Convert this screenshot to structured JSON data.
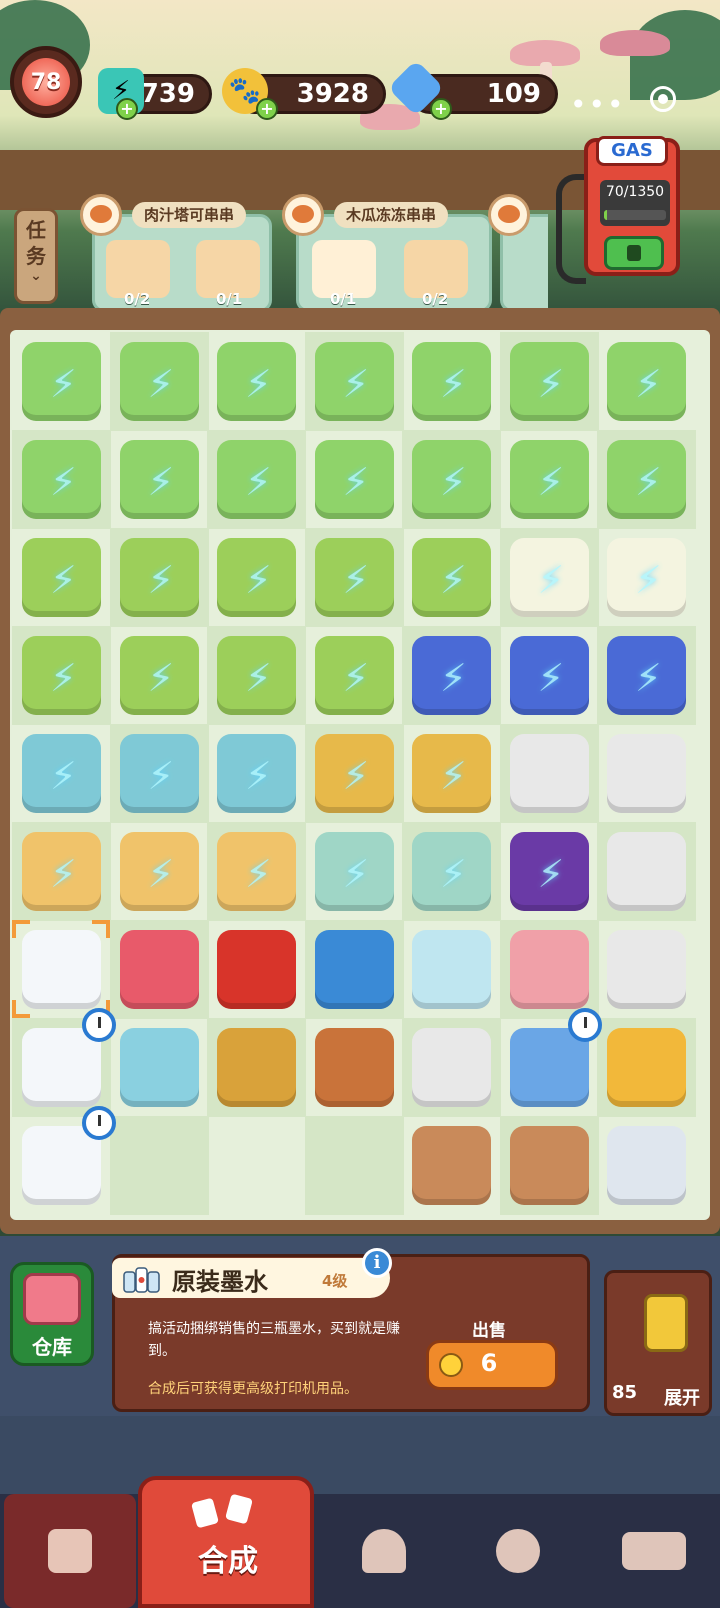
{
  "header": {
    "level": "78",
    "energy": "739",
    "paw_coins": "3928",
    "gems": "109",
    "more_icon": "more-dots-icon",
    "settings_icon": "target-icon"
  },
  "tasks": {
    "tab_label": "任务",
    "cards": [
      {
        "title": "肉汁塔可串串",
        "ingredients": [
          {
            "count": "0/2"
          },
          {
            "count": "0/1"
          }
        ]
      },
      {
        "title": "木瓜冻冻串串",
        "ingredients": [
          {
            "count": "0/1"
          },
          {
            "count": "0/2"
          }
        ]
      }
    ]
  },
  "gas": {
    "label": "GAS",
    "progress": "70/1350",
    "fill_fraction": 0.052
  },
  "selected_item": {
    "name": "原装墨水",
    "level": "4级",
    "description": "搞活动捆绑销售的三瓶墨水，买到就是赚到。",
    "hint": "合成后可获得更高级打印机用品。",
    "sell_label": "出售",
    "sell_value": "6"
  },
  "warehouse_label": "仓库",
  "expand": {
    "count": "85",
    "label": "展开"
  },
  "nav": {
    "active_label": "合成",
    "items": [
      "bag-icon",
      "merge-icon",
      "service-bell-icon",
      "chef-icon",
      "bus-icon"
    ]
  },
  "colors": {
    "board_bg": "#e6f0db",
    "accent_red": "#e04a3a",
    "gas_red": "#e24a3a",
    "sell_orange": "#f08a2a"
  }
}
